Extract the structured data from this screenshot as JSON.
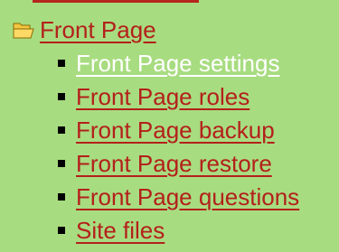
{
  "colors": {
    "background": "#a8dc80",
    "link": "#b3201b",
    "active_link": "#ffffff",
    "bullet": "#000000"
  },
  "tree": {
    "folder_icon": "open-folder-icon",
    "folder_label": "Front Page",
    "items": [
      {
        "label": "Front Page settings",
        "active": true
      },
      {
        "label": "Front Page roles",
        "active": false
      },
      {
        "label": "Front Page backup",
        "active": false
      },
      {
        "label": "Front Page restore",
        "active": false
      },
      {
        "label": "Front Page questions",
        "active": false
      },
      {
        "label": "Site files",
        "active": false
      }
    ]
  }
}
